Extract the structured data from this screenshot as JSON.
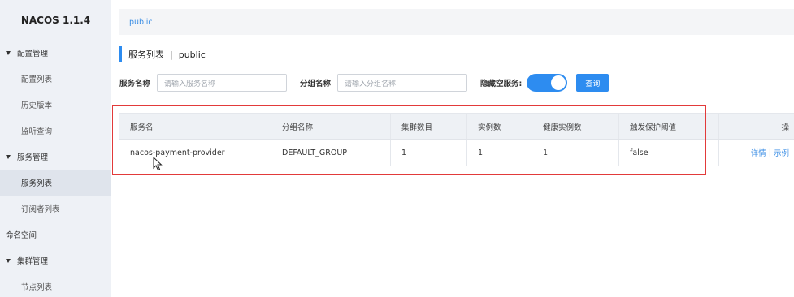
{
  "app": {
    "logo": "NACOS 1.1.4"
  },
  "sidebar": {
    "groups": [
      {
        "label": "配置管理",
        "items": [
          "配置列表",
          "历史版本",
          "监听查询"
        ]
      },
      {
        "label": "服务管理",
        "items": [
          "服务列表",
          "订阅者列表"
        ]
      }
    ],
    "namespace": "命名空间",
    "cluster": {
      "label": "集群管理",
      "items": [
        "节点列表"
      ]
    },
    "active_item": "服务列表"
  },
  "topbar": {
    "namespace": "public"
  },
  "page": {
    "title": "服务列表",
    "separator": "|",
    "namespace": "public"
  },
  "filters": {
    "service_name_label": "服务名称",
    "service_name_placeholder": "请输入服务名称",
    "group_name_label": "分组名称",
    "group_name_placeholder": "请输入分组名称",
    "hide_empty_label": "隐藏空服务:",
    "hide_empty_on": true,
    "query_button": "查询"
  },
  "table": {
    "headers": [
      "服务名",
      "分组名称",
      "集群数目",
      "实例数",
      "健康实例数",
      "触发保护阈值",
      "操"
    ],
    "rows": [
      {
        "service": "nacos-payment-provider",
        "group": "DEFAULT_GROUP",
        "clusters": "1",
        "instances": "1",
        "healthy": "1",
        "threshold": "false",
        "op_detail": "详情",
        "op_sep": "|",
        "op_sample": "示例"
      }
    ]
  },
  "colors": {
    "accent": "#2d8cf0",
    "highlight": "#e23a3a",
    "sidebar_bg": "#eef1f6"
  }
}
